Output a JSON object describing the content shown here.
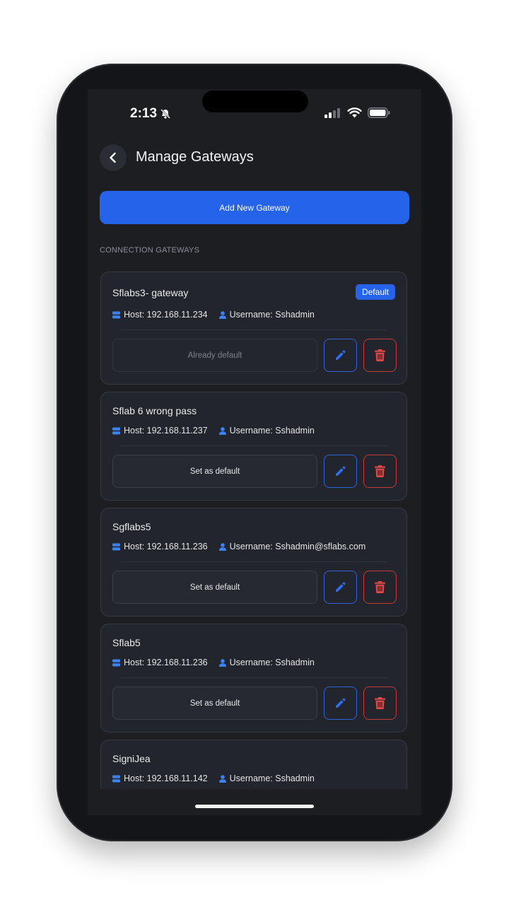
{
  "status_bar": {
    "time": "2:13"
  },
  "header": {
    "title": "Manage Gateways"
  },
  "add_button": {
    "label": "Add New Gateway"
  },
  "section": {
    "label": "CONNECTION GATEWAYS"
  },
  "gateways": [
    {
      "name": "Sflabs3- gateway",
      "badge": "Default",
      "host": "Host: 192.168.11.234",
      "username": "Username: Sshadmin",
      "action": "Already default"
    },
    {
      "name": "Sflab 6 wrong pass",
      "host": "Host: 192.168.11.237",
      "username": "Username: Sshadmin",
      "action": "Set as default"
    },
    {
      "name": "Sgflabs5",
      "host": "Host: 192.168.11.236",
      "username": "Username: Sshadmin@sflabs.com",
      "action": "Set as default"
    },
    {
      "name": "Sflab5",
      "host": "Host: 192.168.11.236",
      "username": "Username: Sshadmin",
      "action": "Set as default"
    },
    {
      "name": "SigniJea",
      "host": "Host: 192.168.11.142",
      "username": "Username: Sshadmin"
    }
  ],
  "colors": {
    "accent": "#2563eb",
    "danger": "#e04848",
    "background": "#1c1e22",
    "card": "#22252b"
  },
  "icons": [
    "chevron-left-icon",
    "bell-slash-icon",
    "signal-icon",
    "wifi-icon",
    "battery-icon",
    "server-icon",
    "user-icon",
    "pencil-icon",
    "trash-icon"
  ]
}
